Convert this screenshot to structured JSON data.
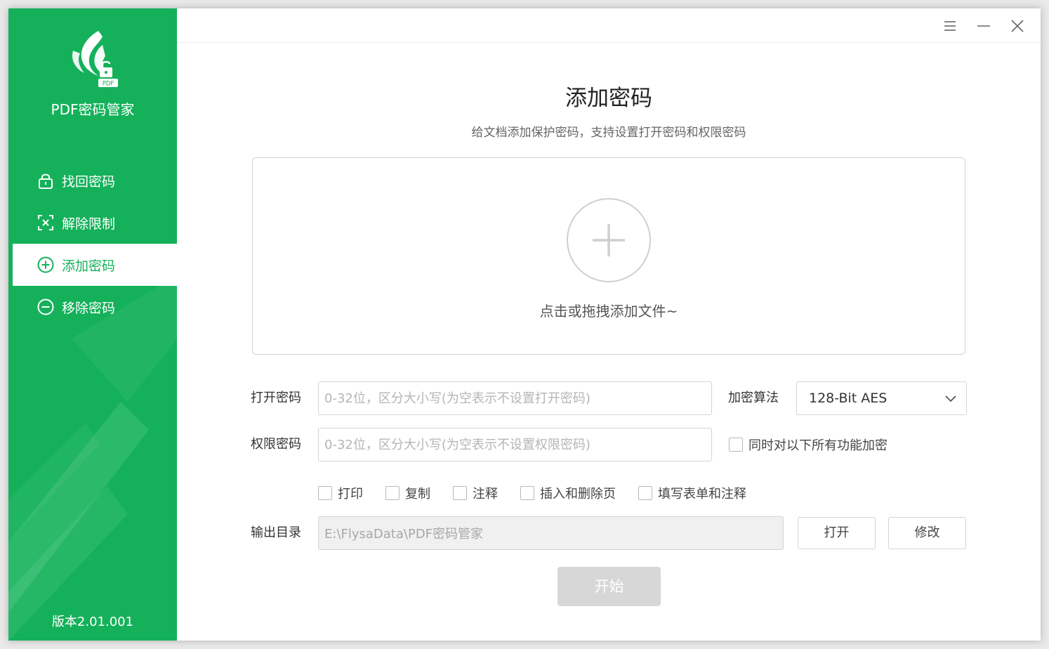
{
  "app": {
    "name": "PDF密码管家",
    "logo_badge": "PDF",
    "version": "版本2.01.001"
  },
  "colors": {
    "brand": "#14b15a",
    "disabled_button": "#d7d7d7"
  },
  "sidebar": {
    "items": [
      {
        "label": "找回密码",
        "icon": "lock-icon",
        "active": false
      },
      {
        "label": "解除限制",
        "icon": "unlock-frame-icon",
        "active": false
      },
      {
        "label": "添加密码",
        "icon": "plus-circle-icon",
        "active": true
      },
      {
        "label": "移除密码",
        "icon": "minus-circle-icon",
        "active": false
      }
    ]
  },
  "titlebar": {
    "menu_icon": "menu-icon",
    "minimize_icon": "minimize-icon",
    "close_icon": "close-icon"
  },
  "main": {
    "title": "添加密码",
    "subtitle": "给文档添加保护密码，支持设置打开密码和权限密码",
    "dropzone_text": "点击或拖拽添加文件~",
    "open_password": {
      "label": "打开密码",
      "value": "",
      "placeholder": "0-32位，区分大小写(为空表示不设置打开密码)"
    },
    "permission_password": {
      "label": "权限密码",
      "value": "",
      "placeholder": "0-32位，区分大小写(为空表示不设置权限密码)"
    },
    "encryption": {
      "label": "加密算法",
      "selected": "128-Bit AES"
    },
    "encrypt_all": {
      "label": "同时对以下所有功能加密",
      "checked": false
    },
    "permissions": [
      {
        "label": "打印",
        "checked": false
      },
      {
        "label": "复制",
        "checked": false
      },
      {
        "label": "注释",
        "checked": false
      },
      {
        "label": "插入和删除页",
        "checked": false
      },
      {
        "label": "填写表单和注释",
        "checked": false
      }
    ],
    "output": {
      "label": "输出目录",
      "value": "E:\\FlysaData\\PDF密码管家",
      "open_label": "打开",
      "modify_label": "修改"
    },
    "start_label": "开始"
  }
}
